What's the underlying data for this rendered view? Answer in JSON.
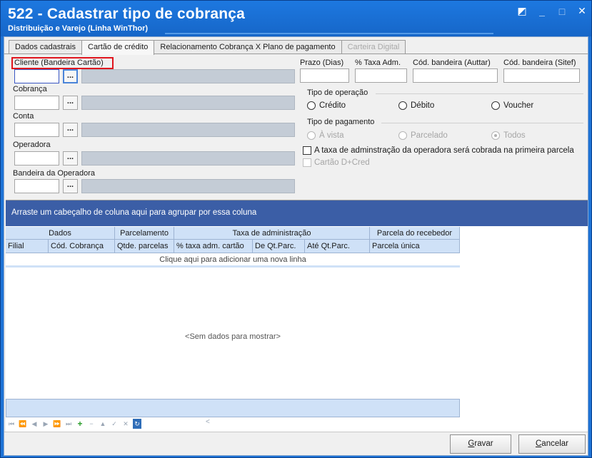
{
  "window": {
    "title": "522 - Cadastrar tipo de cobrança",
    "subtitle": "Distribuição e Varejo (Linha WinThor)",
    "controls": {
      "restore": "◩",
      "minimize": "_",
      "maximize": "□",
      "close": "✕"
    }
  },
  "tabs": [
    {
      "label": "Dados cadastrais"
    },
    {
      "label": "Cartão de crédito"
    },
    {
      "label": "Relacionamento Cobrança X Plano de pagamento"
    },
    {
      "label": "Carteira Digital"
    }
  ],
  "form": {
    "cliente_label": "Cliente (Bandeira Cartão)",
    "cobranca_label": "Cobrança",
    "conta_label": "Conta",
    "operadora_label": "Operadora",
    "bandeira_operadora_label": "Bandeira da Operadora",
    "ellipsis": "...",
    "prazo_label": "Prazo (Dias)",
    "taxa_label": "% Taxa Adm.",
    "cod_auttar_label": "Cód. bandeira (Auttar)",
    "cod_sitef_label": "Cód. bandeira (Sitef)"
  },
  "tipo_operacao": {
    "title": "Tipo de operação",
    "options": [
      "Crédito",
      "Débito",
      "Voucher"
    ]
  },
  "tipo_pagamento": {
    "title": "Tipo de pagamento",
    "options": [
      "À vista",
      "Parcelado",
      "Todos"
    ],
    "selected": "Todos"
  },
  "checks": {
    "taxa_primeira_parcela": "A taxa de adminstração da operadora será cobrada na primeira parcela",
    "cartao_dcred": "Cartão D+Cred"
  },
  "grid": {
    "group_panel": "Arraste um cabeçalho de coluna aqui para agrupar por essa coluna",
    "bands": [
      "Dados",
      "Parcelamento",
      "Taxa de administração",
      "Parcela do recebedor"
    ],
    "columns": [
      "Filial",
      "Cód. Cobrança",
      "Qtde. parcelas",
      "% taxa adm. cartão",
      "De Qt.Parc.",
      "Até Qt.Parc.",
      "Parcela única"
    ],
    "new_row": "Clique aqui para adicionar uma nova linha",
    "no_data": "<Sem dados para mostrar>"
  },
  "navigator": {
    "first": "⏮",
    "prev_page": "⏪",
    "prev": "◀",
    "next": "▶",
    "next_page": "⏩",
    "last": "⏭",
    "append": "+",
    "delete": "−",
    "edit": "▲",
    "post": "✓",
    "cancel": "✕",
    "refresh": "↻",
    "scroll_left": "<"
  },
  "buttons": {
    "gravar_u": "G",
    "gravar_rest": "ravar",
    "cancelar_u": "C",
    "cancelar_rest": "ancelar"
  },
  "colors": {
    "title_bar": "#1d78e0",
    "group_panel": "#3b5ea6",
    "grid_header": "#cfe1f7",
    "highlight_box": "#e0141d"
  }
}
